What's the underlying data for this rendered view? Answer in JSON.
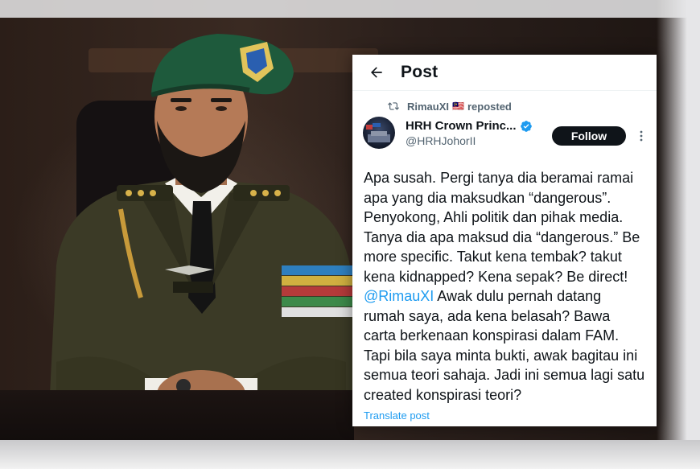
{
  "post_card": {
    "header_title": "Post",
    "repost": {
      "user": "RimauXI",
      "flag_emoji": "🇲🇾",
      "label": "reposted"
    },
    "author": {
      "display_name": "HRH Crown Princ...",
      "handle": "@HRHJohorII",
      "verified": true
    },
    "follow_label": "Follow",
    "body_before_mention": "Apa susah. Pergi tanya dia beramai ramai apa yang dia maksudkan “dangerous”. Penyokong, Ahli politik dan pihak media. Tanya dia apa maksud dia “dangerous.” Be more specific. Takut kena tembak? takut kena kidnapped? Kena sepak? Be direct! ",
    "mention": "@RimauXI",
    "body_after_mention": " Awak dulu pernah datang rumah saya, ada kena belasah? Bawa carta berkenaan konspirasi dalam FAM. Tapi bila saya minta bukti, awak bagitau ini semua teori sahaja. Jadi ini semua lagi satu created konspirasi teori?",
    "translate_label": "Translate post"
  },
  "colors": {
    "accent": "#1d9bf0",
    "text": "#0f1419",
    "muted": "#536471",
    "beret": "#1e5a3c"
  },
  "icons": [
    "back-arrow-icon",
    "repost-icon",
    "verified-badge-icon",
    "more-options-icon"
  ]
}
